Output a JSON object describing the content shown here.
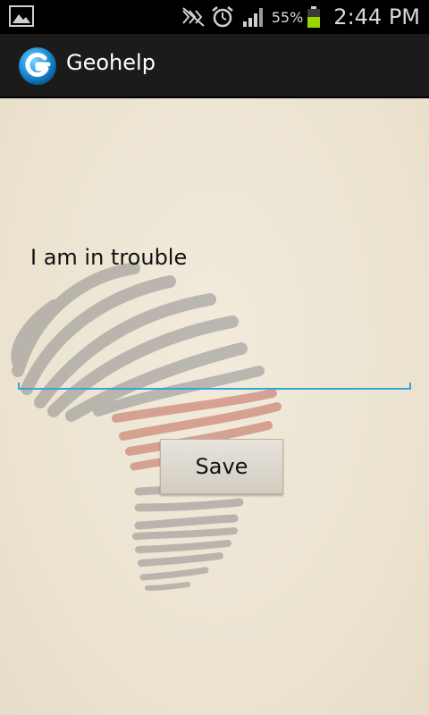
{
  "status_bar": {
    "left_icon": "image-icon",
    "icons": [
      "mute-icon",
      "alarm-icon",
      "signal-icon"
    ],
    "battery_percent": "55%",
    "battery_level": 0.55,
    "time": "2:44 PM"
  },
  "action_bar": {
    "title": "Geohelp",
    "logo_icon": "geohelp-logo-icon",
    "accent_color": "#2196d9"
  },
  "main": {
    "message_label": "I am in trouble",
    "input": {
      "value": "",
      "placeholder": ""
    },
    "save_label": "Save",
    "input_accent_color": "#33a6d6",
    "watermark": "africa-map-icon"
  }
}
